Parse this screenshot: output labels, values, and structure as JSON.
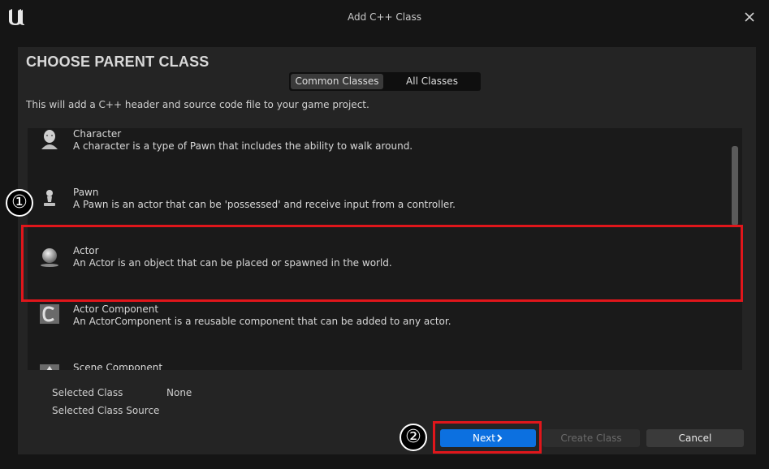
{
  "window": {
    "title": "Add C++ Class",
    "logo_glyph": "U"
  },
  "dialog": {
    "heading": "CHOOSE PARENT CLASS",
    "tabs": [
      {
        "label": "Common Classes",
        "active": true
      },
      {
        "label": "All Classes",
        "active": false
      }
    ],
    "description": "This will add a C++ header and source code file to your game project."
  },
  "class_list": [
    {
      "name": "Character",
      "description": "A character is a type of Pawn that includes the ability to walk around.",
      "icon": "character-icon"
    },
    {
      "name": "Pawn",
      "description": "A Pawn is an actor that can be 'possessed' and receive input from a controller.",
      "icon": "pawn-icon"
    },
    {
      "name": "Actor",
      "description": "An Actor is an object that can be placed or spawned in the world.",
      "icon": "actor-sphere-icon"
    },
    {
      "name": "Actor Component",
      "description": "An ActorComponent is a reusable component that can be added to any actor.",
      "icon": "actor-component-icon"
    },
    {
      "name": "Scene Component",
      "description": "",
      "icon": "scene-component-icon"
    }
  ],
  "selection": {
    "class_label": "Selected Class",
    "class_value": "None",
    "source_label": "Selected Class Source"
  },
  "buttons": {
    "next": "Next",
    "next_icon": "chevron-right-icon",
    "create": "Create Class",
    "cancel": "Cancel"
  },
  "annotations": {
    "step1": "①",
    "step2": "②",
    "highlight_color": "#e0161b"
  },
  "colors": {
    "accent": "#0c70e0",
    "panel": "#242424",
    "list_bg": "#1a1a1a"
  }
}
